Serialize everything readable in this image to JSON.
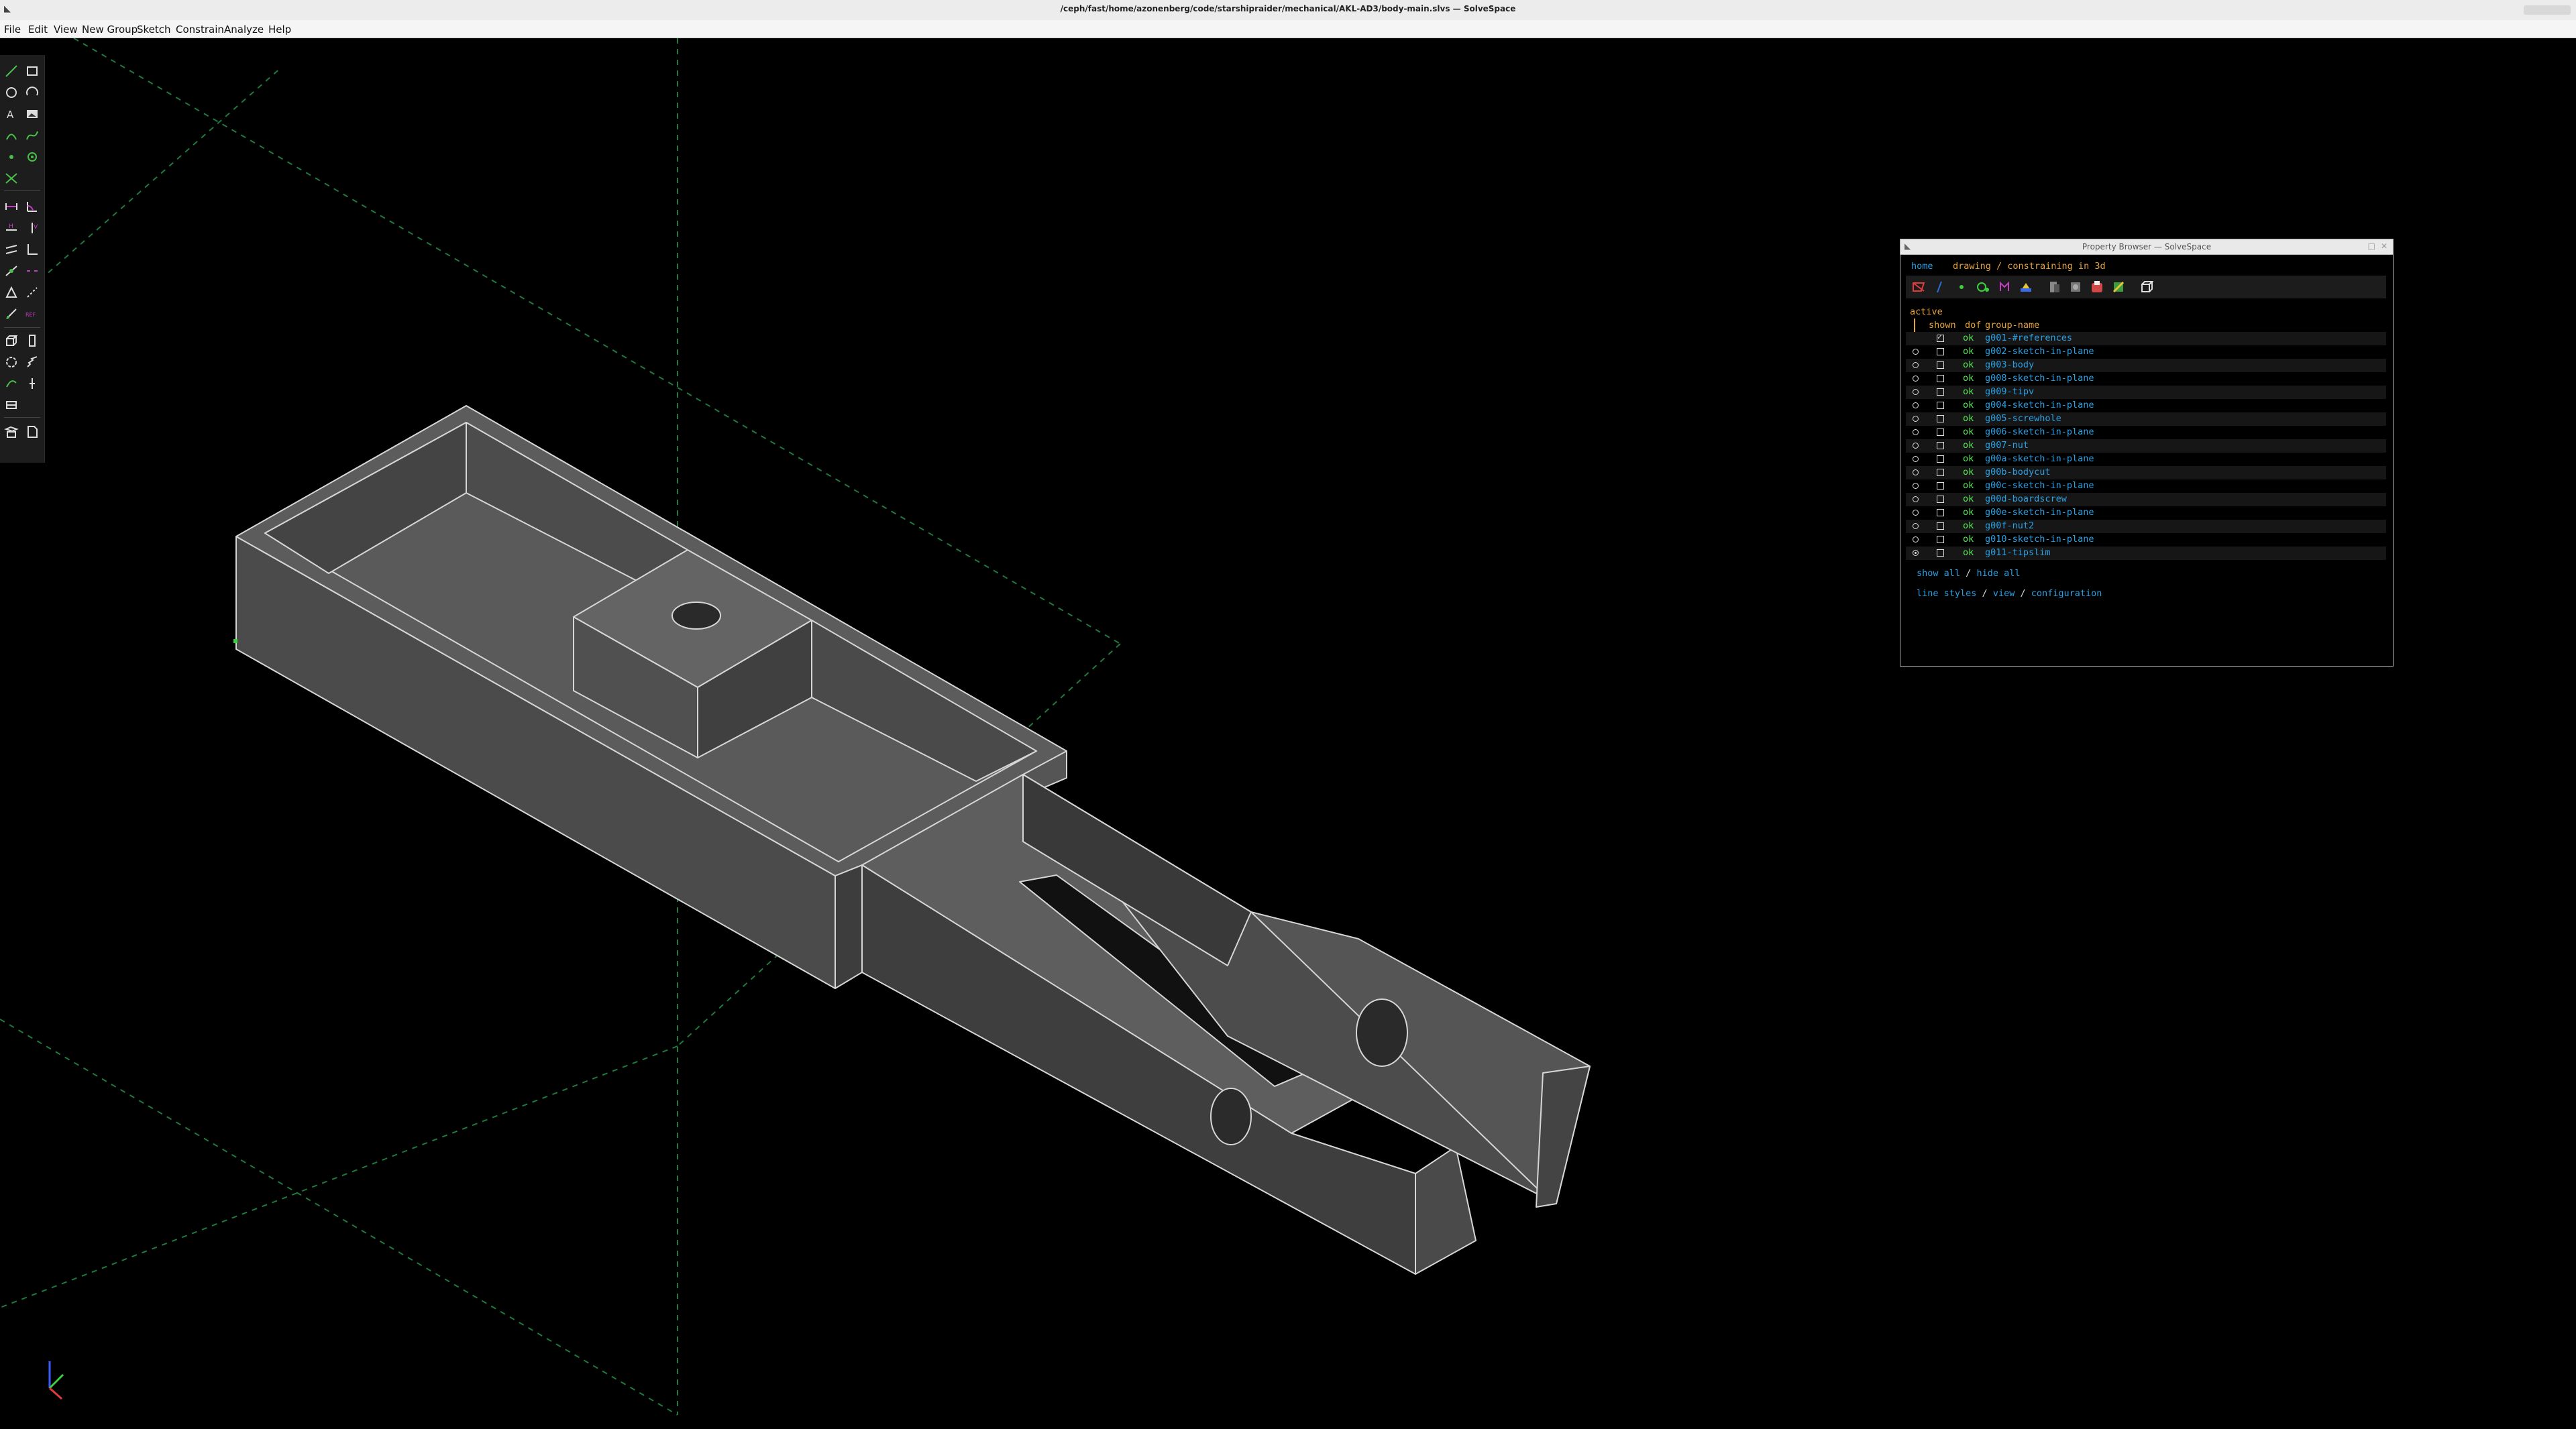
{
  "window": {
    "title": "/ceph/fast/home/azonenberg/code/starshipraider/mechanical/AKL-AD3/body-main.slvs — SolveSpace"
  },
  "menu": [
    "File",
    "Edit",
    "View",
    "New Group",
    "Sketch",
    "Constrain",
    "Analyze",
    "Help"
  ],
  "toolbar": [
    "line-segment-icon",
    "rectangle-icon",
    "circle-icon",
    "arc-icon",
    "text-icon",
    "image-icon",
    "tangent-arc-icon",
    "cubic-spline-icon",
    "datum-point-icon",
    "workplane-icon",
    "split-curves-icon",
    "distance-constraint-icon",
    "angle-constraint-icon",
    "horizontal-constraint-icon",
    "vertical-constraint-icon",
    "parallel-constraint-icon",
    "perpendicular-constraint-icon",
    "point-on-line-icon",
    "symmetric-constraint-icon",
    "equal-length-icon",
    "other-supplementary-icon",
    "reference-icon",
    "ref-label-icon",
    "extrude-icon",
    "lathe-icon",
    "revolve-icon",
    "helix-icon",
    "step-rotating-icon",
    "step-translating-icon",
    "link-icon",
    "workplane-nearest-icon",
    "solvespace-unknown-icon",
    "in-workplane-icon",
    "in-3d-icon"
  ],
  "property_browser": {
    "title": "Property Browser — SolveSpace",
    "nav": {
      "home": "home",
      "context": "drawing / constraining in 3d"
    },
    "icons": [
      "workplanes-icon",
      "normals-icon",
      "points-icon",
      "constraints-icon",
      "faces-icon",
      "outlines-icon",
      "shaded-icon",
      "mesh-icon",
      "hidden-lines-icon",
      "solid-icon",
      "edges-icon",
      "perspective-icon"
    ],
    "section_label": "active",
    "headers": {
      "shown": "shown",
      "dof": "dof",
      "group_name": "group-name"
    },
    "groups": [
      {
        "name": "g001-#references",
        "status": "ok",
        "shown": true,
        "active": false
      },
      {
        "name": "g002-sketch-in-plane",
        "status": "ok",
        "shown": false,
        "active": false
      },
      {
        "name": "g003-body",
        "status": "ok",
        "shown": false,
        "active": false
      },
      {
        "name": "g008-sketch-in-plane",
        "status": "ok",
        "shown": false,
        "active": false
      },
      {
        "name": "g009-tipv",
        "status": "ok",
        "shown": false,
        "active": false
      },
      {
        "name": "g004-sketch-in-plane",
        "status": "ok",
        "shown": false,
        "active": false
      },
      {
        "name": "g005-screwhole",
        "status": "ok",
        "shown": false,
        "active": false
      },
      {
        "name": "g006-sketch-in-plane",
        "status": "ok",
        "shown": false,
        "active": false
      },
      {
        "name": "g007-nut",
        "status": "ok",
        "shown": false,
        "active": false
      },
      {
        "name": "g00a-sketch-in-plane",
        "status": "ok",
        "shown": false,
        "active": false
      },
      {
        "name": "g00b-bodycut",
        "status": "ok",
        "shown": false,
        "active": false
      },
      {
        "name": "g00c-sketch-in-plane",
        "status": "ok",
        "shown": false,
        "active": false
      },
      {
        "name": "g00d-boardscrew",
        "status": "ok",
        "shown": false,
        "active": false
      },
      {
        "name": "g00e-sketch-in-plane",
        "status": "ok",
        "shown": false,
        "active": false
      },
      {
        "name": "g00f-nut2",
        "status": "ok",
        "shown": false,
        "active": false
      },
      {
        "name": "g010-sketch-in-plane",
        "status": "ok",
        "shown": false,
        "active": false
      },
      {
        "name": "g011-tipslim",
        "status": "ok",
        "shown": false,
        "active": true
      }
    ],
    "links": {
      "show_all": "show all",
      "sep1": "/",
      "hide_all": "hide all",
      "line_styles": "line styles",
      "sep2": "/",
      "view": "view",
      "sep3": "/",
      "configuration": "configuration"
    }
  },
  "colors": {
    "background": "#000000",
    "link": "#2aa1e5",
    "ok": "#58e858",
    "accent": "#e8a23a",
    "model_face": "#5c5c5c",
    "model_edge": "#d6d6d6",
    "grid": "#1f7a3d"
  }
}
